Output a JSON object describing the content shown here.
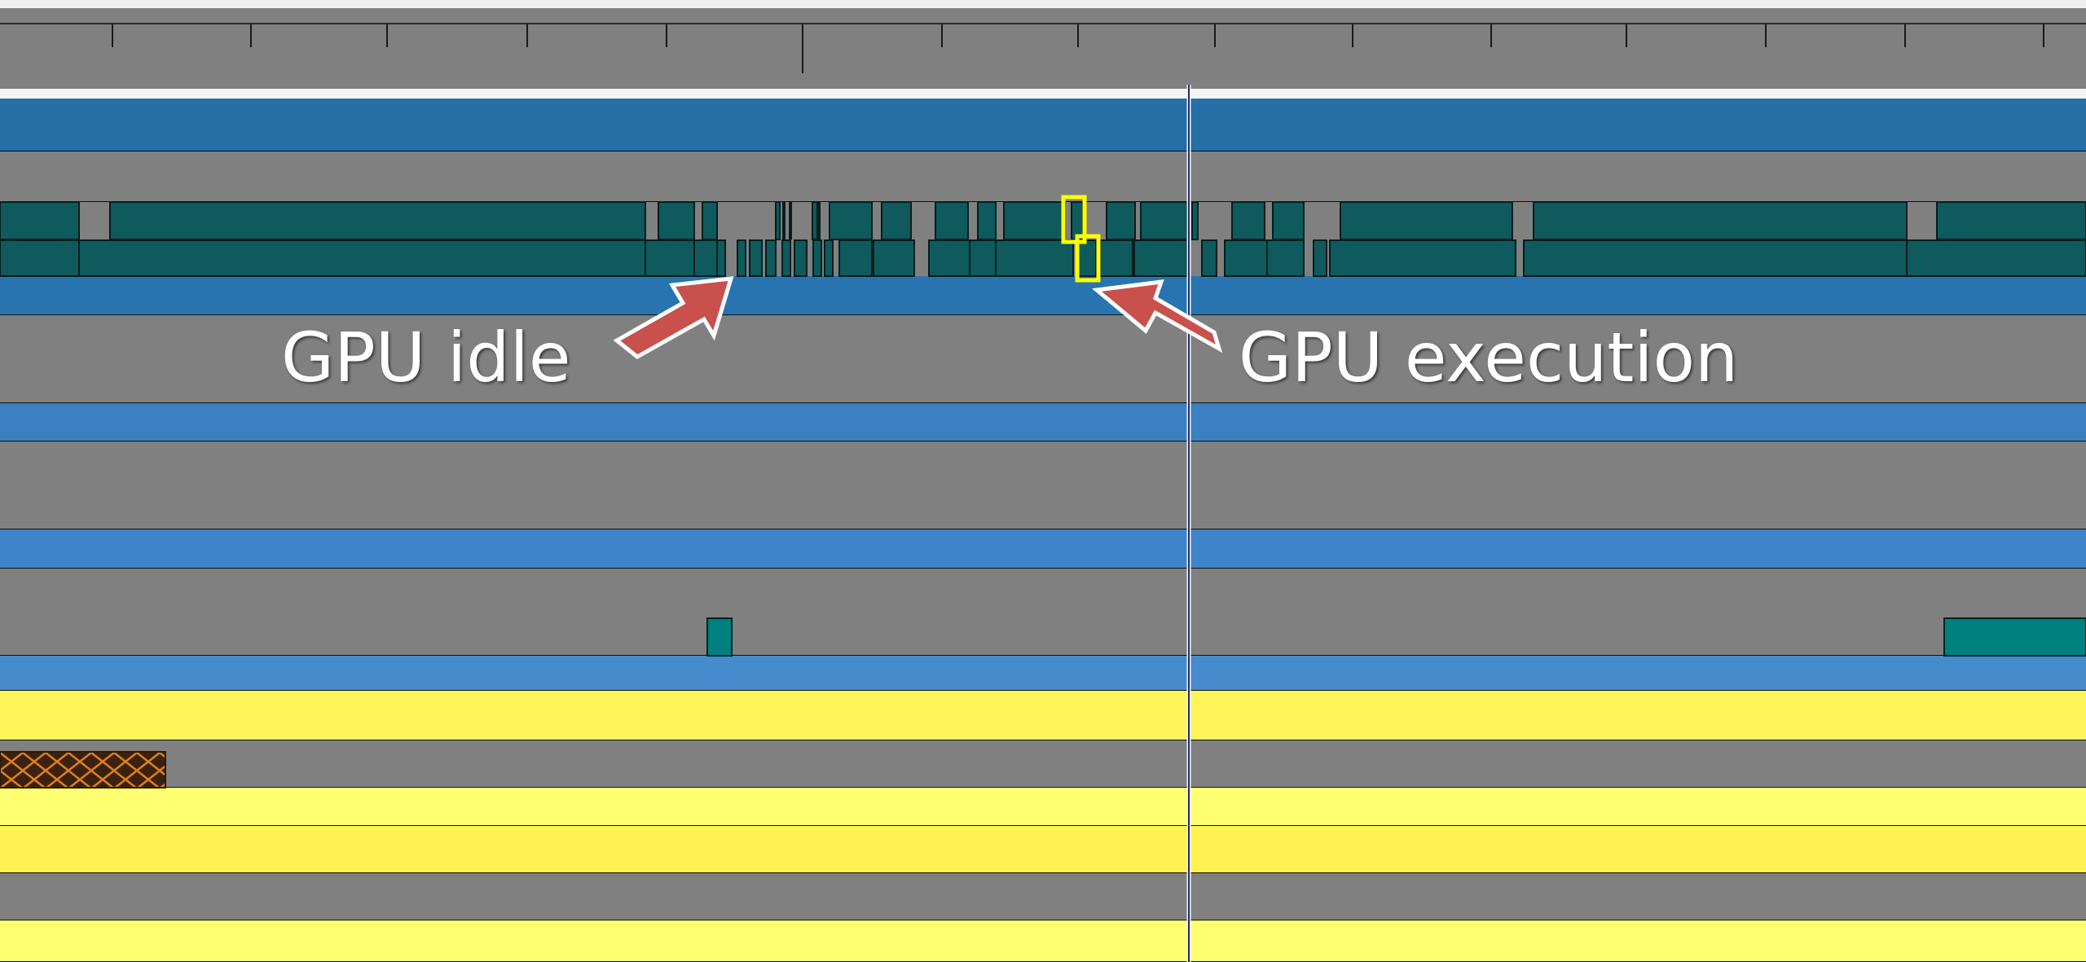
{
  "annotations": {
    "idle_label": "GPU idle",
    "execution_label": "GPU execution"
  },
  "colors": {
    "background": "#808080",
    "blue_lane": "#2470a6",
    "gpu_packet": "#0e5a5d",
    "selected_packet": "#ffff00",
    "arrow": "#c8504d",
    "yellow_lane": "#fff45a",
    "cursor_line": "#1f2a6b"
  }
}
